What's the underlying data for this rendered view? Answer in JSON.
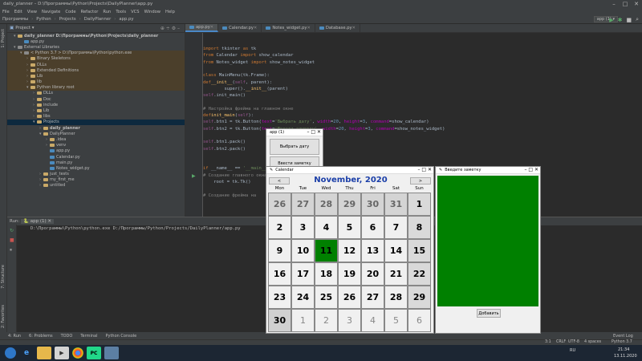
{
  "window": {
    "title": "daily_planner – D:\\Программы\\Python\\Projects\\DailyPlanner\\app.py"
  },
  "menu": [
    "File",
    "Edit",
    "View",
    "Navigate",
    "Code",
    "Refactor",
    "Run",
    "Tools",
    "VCS",
    "Window",
    "Help"
  ],
  "nav": {
    "crumbs": [
      "Программы",
      "Python",
      "Projects",
      "DailyPlanner",
      "app.py"
    ],
    "run_config": "app (1)"
  },
  "project": {
    "header": "Project",
    "rows": [
      {
        "label": "daily_planner  D:\\Программы\\Python\\Projects\\daily_planner",
        "indent": 1,
        "icon": "folder",
        "arrow": "▾",
        "bold": true
      },
      {
        "label": "app.py",
        "indent": 2,
        "icon": "py",
        "arrow": ""
      },
      {
        "label": "External Libraries",
        "indent": 1,
        "icon": "lib",
        "arrow": "▾"
      },
      {
        "label": "< Python 3.7 >  D:\\Программы\\Python\\python.exe",
        "indent": 2,
        "icon": "lib",
        "arrow": "▾",
        "hl": true
      },
      {
        "label": "Binary Skeletons",
        "indent": 3,
        "icon": "folder",
        "arrow": "›",
        "hl": true
      },
      {
        "label": "DLLs",
        "indent": 3,
        "icon": "folder",
        "arrow": "›",
        "hl": true
      },
      {
        "label": "Extended Definitions",
        "indent": 3,
        "icon": "folder",
        "arrow": "›",
        "hl": true
      },
      {
        "label": "Lib",
        "indent": 3,
        "icon": "folder",
        "arrow": "›",
        "hl": true
      },
      {
        "label": "lib",
        "indent": 3,
        "icon": "folder",
        "arrow": "›",
        "hl": true
      },
      {
        "label": "Python  library root",
        "indent": 3,
        "icon": "folder",
        "arrow": "▾",
        "hl": true
      },
      {
        "label": "DLLs",
        "indent": 4,
        "icon": "folder",
        "arrow": "›"
      },
      {
        "label": "Doc",
        "indent": 4,
        "icon": "folder",
        "arrow": "›"
      },
      {
        "label": "include",
        "indent": 4,
        "icon": "folder",
        "arrow": "›"
      },
      {
        "label": "Lib",
        "indent": 4,
        "icon": "folder",
        "arrow": "›"
      },
      {
        "label": "libs",
        "indent": 4,
        "icon": "folder",
        "arrow": "›"
      },
      {
        "label": "Projects",
        "indent": 4,
        "icon": "folder",
        "arrow": "▾",
        "sel": true
      },
      {
        "label": "daily_planner",
        "indent": 5,
        "icon": "folder",
        "arrow": "›",
        "bold": true
      },
      {
        "label": "DailyPlanner",
        "indent": 5,
        "icon": "folder",
        "arrow": "▾"
      },
      {
        "label": ".idea",
        "indent": 6,
        "icon": "folder",
        "arrow": "›"
      },
      {
        "label": "venv",
        "indent": 6,
        "icon": "folder",
        "arrow": "›"
      },
      {
        "label": "app.py",
        "indent": 6,
        "icon": "py",
        "arrow": ""
      },
      {
        "label": "Calendar.py",
        "indent": 6,
        "icon": "py",
        "arrow": ""
      },
      {
        "label": "main.py",
        "indent": 6,
        "icon": "py",
        "arrow": ""
      },
      {
        "label": "Notes_widget.py",
        "indent": 6,
        "icon": "py",
        "arrow": ""
      },
      {
        "label": "just_tests",
        "indent": 5,
        "icon": "folder",
        "arrow": "›"
      },
      {
        "label": "my_first_me",
        "indent": 5,
        "icon": "folder",
        "arrow": "›"
      },
      {
        "label": "untitled",
        "indent": 5,
        "icon": "folder",
        "arrow": "›"
      }
    ]
  },
  "editor_tabs": [
    "app.py",
    "Calendar.py",
    "Notes_widget.py",
    "Database.py"
  ],
  "code_lines": [
    "<span class='kw'>import</span> tkinter <span class='kw'>as</span> tk",
    "<span class='kw'>from</span> Calendar <span class='kw'>import</span> show_calendar",
    "<span class='kw'>from</span> Notes_widget <span class='kw'>import</span> show_notes_widget",
    "",
    "<span class='kw'>class</span> MainMenu(tk.Frame):",
    "    <span class='kw'>def</span> <span class='fn'>__init__</span>(<span class='self'>self</span>, parent):",
    "        super().<span class='fn'>__init__</span>(parent)",
    "        <span class='self'>self</span>.init_main()",
    "",
    "    <span class='cm'># Настройка фрейма на главном окне</span>",
    "    <span class='kw'>def</span> <span class='fn'>init_main</span>(<span class='self'>self</span>):",
    "        <span class='self'>self</span>.btn1 = tk.Button(<span class='dec'>text</span>=<span class='str'>'Выбрать дату'</span>, <span class='dec'>width</span>=<span class='num'>20</span>, <span class='dec'>height</span>=<span class='num'>3</span>, <span class='dec'>command</span>=show_calendar)",
    "        <span class='self'>self</span>.btn2 = tk.Button(<span class='dec'>text</span>=<span class='str'>'Ввести заметку'</span>, <span class='dec'>width</span>=<span class='num'>20</span>, <span class='dec'>height</span>=<span class='num'>3</span>, <span class='dec'>command</span>=show_notes_widget)",
    "",
    "        <span class='self'>self</span>.btn1.pack()",
    "        <span class='self'>self</span>.btn2.pack()",
    "",
    "",
    "<span class='kw'>if</span> __name__ == <span class='str'>'__main__'</span>:",
    "    <span class='cm'># Создание главного окна</span>",
    "    root = tk.Tk()",
    "",
    "    <span class='cm'># Создание фрейма на</span>"
  ],
  "run": {
    "tab_label": "Run:",
    "config": "app (1)",
    "output": "D:\\Программы\\Python\\python.exe D:/Программы/Python/Projects/DailyPlanner/app.py"
  },
  "bottom_tabs": [
    "4: Run",
    "6: Problems",
    "TODO",
    "Terminal",
    "Python Console"
  ],
  "status": {
    "pos": "3:1",
    "crlf": "CRLF",
    "enc": "UTF-8",
    "indent": "4 spaces",
    "interp": "Python 3.7",
    "event_log": "Event Log"
  },
  "app_window": {
    "title": "app (1)",
    "btn1": "Выбрать дату",
    "btn2": "Ввести заметку"
  },
  "calendar": {
    "title": "Calendar",
    "month": "November, 2020",
    "prev": "<",
    "next": ">",
    "weekdays": [
      "Mon",
      "Tue",
      "Wed",
      "Thu",
      "Fri",
      "Sat",
      "Sun"
    ],
    "days": [
      26,
      27,
      28,
      29,
      30,
      31,
      1,
      2,
      3,
      4,
      5,
      6,
      7,
      8,
      9,
      10,
      11,
      12,
      13,
      14,
      15,
      16,
      17,
      18,
      19,
      20,
      21,
      22,
      23,
      24,
      25,
      26,
      27,
      28,
      29,
      30,
      1,
      2,
      3,
      4,
      5,
      6
    ],
    "today": 11,
    "today_color": "#008000"
  },
  "notes": {
    "title": "Введите заметку",
    "button": "Добавить",
    "bg": "#008000"
  },
  "clock": {
    "time": "21:34",
    "date": "13.11.2020",
    "lang": "RU"
  }
}
